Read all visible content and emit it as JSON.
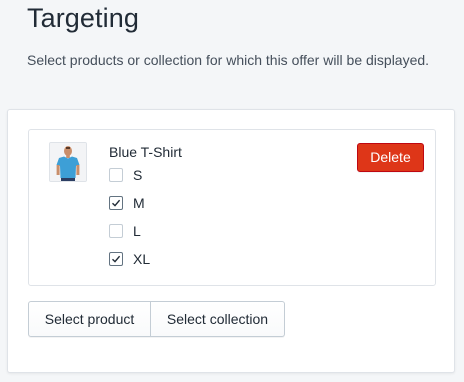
{
  "header": {
    "title": "Targeting",
    "subtitle": "Select products or collection for which this offer will be displayed."
  },
  "product": {
    "name": "Blue T-Shirt",
    "thumbnail_icon": "blue-tshirt-product-image",
    "variants": [
      {
        "label": "S",
        "checked": false
      },
      {
        "label": "M",
        "checked": true
      },
      {
        "label": "L",
        "checked": false
      },
      {
        "label": "XL",
        "checked": true
      }
    ],
    "delete_label": "Delete"
  },
  "actions": {
    "select_product_label": "Select product",
    "select_collection_label": "Select collection"
  },
  "colors": {
    "delete_button": "#de3618",
    "page_background": "#f4f6f8",
    "shirt_blue": "#3d9fd6"
  }
}
